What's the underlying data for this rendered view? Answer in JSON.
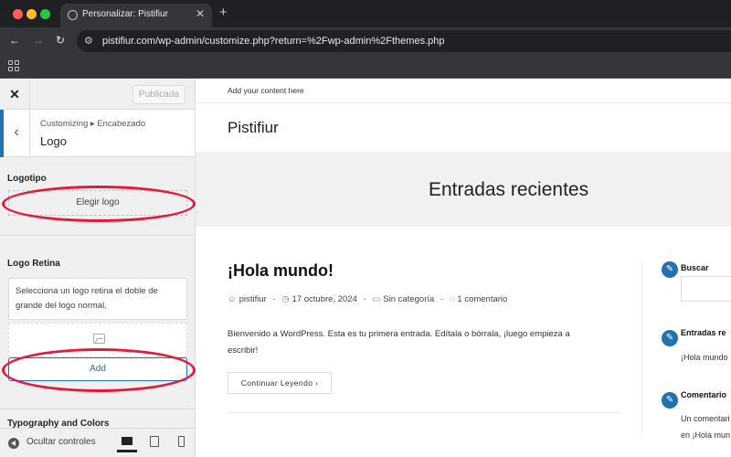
{
  "browser": {
    "tab_title": "Personalizar: Pistifiur",
    "tab_close": "✕",
    "new_tab": "+",
    "url": "pistifiur.com/wp-admin/customize.php?return=%2Fwp-admin%2Fthemes.php"
  },
  "customizer": {
    "close": "✕",
    "publish_label": "Publicada",
    "breadcrumb": "Customizing ▸ Encabezado",
    "section_title": "Logo",
    "logo_label": "Logotipo",
    "choose_logo": "Elegir logo",
    "retina_label": "Logo Retina",
    "retina_description": "Selecciona un logo retina el doble de grande del logo normal.",
    "add_label": "Add",
    "next_section": "Typography and Colors",
    "hide_controls": "Ocultar controles"
  },
  "preview": {
    "topbar_text": "Add your content here",
    "site_title": "Pistifiur",
    "hero_title": "Entradas recientes",
    "post": {
      "title": "¡Hola mundo!",
      "author": "pistifiur",
      "date": "17 octubre, 2024",
      "category": "Sin categoría",
      "comments": "1 comentario",
      "excerpt": "Bienvenido a WordPress. Esta es tu primera entrada. Edítala o bórrala, ¡luego empieza a escribir!",
      "continue": "Continuar Leyendo  ›"
    },
    "widgets": {
      "search_title": "Buscar",
      "recent_title": "Entradas re",
      "recent_item": "¡Hola mundo",
      "comments_title": "Comentario",
      "comments_line1": "Un comentari",
      "comments_line2": "en ¡Hola mun"
    }
  },
  "colors": {
    "accent": "#2271b1",
    "annotation": "#e01b3c"
  }
}
